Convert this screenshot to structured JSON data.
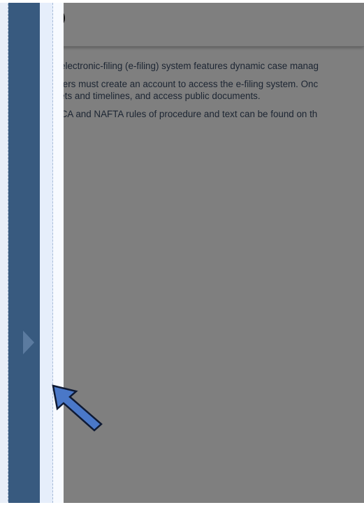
{
  "page": {
    "paragraphs": [
      "This electronic-filing (e-filing) system features dynamic case manag",
      "All users must create an account to access the e-filing system. Onc",
      "dockets and timelines, and access public documents.",
      "USMCA and NAFTA rules of procedure and text can be found on th"
    ]
  },
  "icons": {
    "logo": "circular-logo-icon",
    "toggle": "chevron-right-icon",
    "pointer": "arrow-pointer-icon"
  },
  "colors": {
    "side_panel": "#385a7f",
    "toggle": "#5b7ba0",
    "text": "#3a4c66",
    "pointer_fill": "#4a78c8",
    "overlay": "rgba(0,0,0,0.5)"
  }
}
